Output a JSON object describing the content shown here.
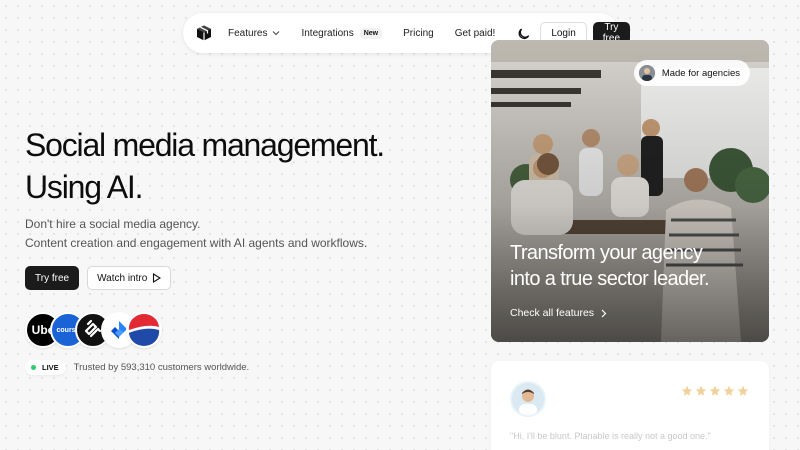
{
  "nav": {
    "logo_icon": "box-cube-icon",
    "features_label": "Features",
    "integrations_label": "Integrations",
    "integrations_badge": "New",
    "pricing_label": "Pricing",
    "get_paid_label": "Get paid!",
    "theme_icon": "moon-icon",
    "login_label": "Login",
    "try_free_label": "Try free"
  },
  "hero": {
    "title_line1": "Social media management.",
    "title_line2": "Using AI.",
    "subtitle_line1": "Don't hire a social media agency.",
    "subtitle_line2": "Content creation and engagement with AI agents and workflows.",
    "try_free_label": "Try free",
    "watch_intro_label": "Watch intro",
    "logos": [
      {
        "name": "Uber",
        "text": "Ube"
      },
      {
        "name": "Coursera",
        "text": "course"
      },
      {
        "name": "Squarespace",
        "text": ""
      },
      {
        "name": "Jira",
        "text": ""
      },
      {
        "name": "Pepsi",
        "text": ""
      }
    ],
    "live_label": "LIVE",
    "trusted_text": "Trusted by 593,310 customers worldwide."
  },
  "photo_card": {
    "badge_label": "Made for agencies",
    "heading_line1": "Transform your agency",
    "heading_line2": "into a true sector leader.",
    "link_label": "Check all features"
  },
  "review_card": {
    "rating": 5,
    "star_color": "#f2d19a",
    "text": "\"Hi, I'll be blunt. Planable is really not a good one.\""
  },
  "colors": {
    "primary_dark": "#1b1b1b",
    "live_green": "#2ecc71"
  }
}
